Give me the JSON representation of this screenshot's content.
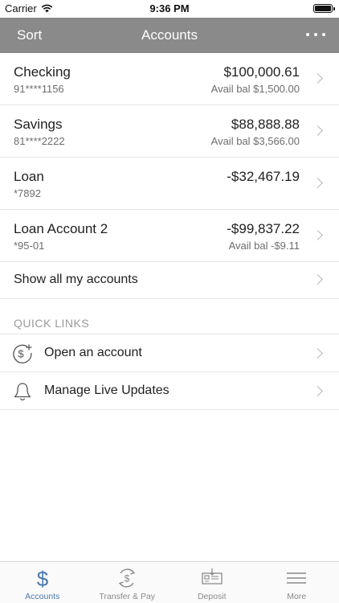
{
  "status_bar": {
    "carrier": "Carrier",
    "time": "9:36 PM"
  },
  "nav": {
    "sort_label": "Sort",
    "title": "Accounts"
  },
  "accounts": [
    {
      "name": "Checking",
      "number": "91****1156",
      "balance": "$100,000.61",
      "available": "Avail bal $1,500.00"
    },
    {
      "name": "Savings",
      "number": "81****2222",
      "balance": "$88,888.88",
      "available": "Avail bal $3,566.00"
    },
    {
      "name": "Loan",
      "number": "*7892",
      "balance": "-$32,467.19",
      "available": ""
    },
    {
      "name": "Loan Account 2",
      "number": "*95-01",
      "balance": "-$99,837.22",
      "available": "Avail bal -$9.11"
    }
  ],
  "show_all_label": "Show all my accounts",
  "quick_links": {
    "header": "QUICK LINKS",
    "items": [
      {
        "label": "Open an account",
        "icon": "dollar-plus-icon"
      },
      {
        "label": "Manage Live Updates",
        "icon": "bell-icon"
      }
    ]
  },
  "tabs": [
    {
      "label": "Accounts",
      "icon": "dollar-icon",
      "active": true
    },
    {
      "label": "Transfer & Pay",
      "icon": "transfer-icon",
      "active": false
    },
    {
      "label": "Deposit",
      "icon": "check-deposit-icon",
      "active": false
    },
    {
      "label": "More",
      "icon": "menu-icon",
      "active": false
    }
  ],
  "colors": {
    "nav_bg": "#8a8a8a",
    "active_tab": "#4a79ab",
    "inactive_tab": "#8a8a8a"
  }
}
